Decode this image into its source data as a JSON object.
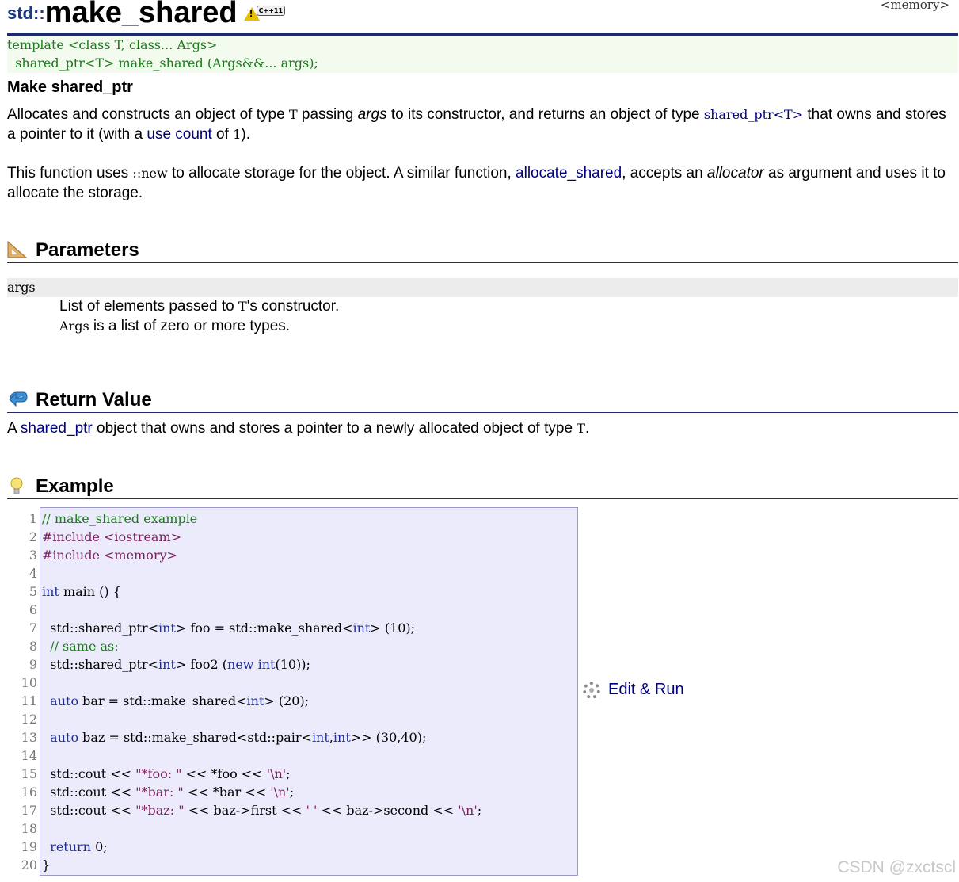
{
  "page": {
    "namespace": "std::",
    "function_name": "make_shared",
    "cxx_badge": "C++11",
    "header": "<memory>",
    "prototype": [
      "template <class T, class... Args>",
      "  shared_ptr<T> make_shared (Args&&... args);"
    ],
    "subtitle": "Make shared_ptr"
  },
  "description": {
    "p1_a": "Allocates and constructs an object of type ",
    "p1_T": "T",
    "p1_b": " passing ",
    "p1_args": "args",
    "p1_c": " to its constructor, and returns an object of type ",
    "p1_link": "shared_ptr<T>",
    "p1_d": " that owns and stores a pointer to it (with a ",
    "p1_link2": "use count",
    "p1_e": " of ",
    "p1_one": "1",
    "p1_f": ").",
    "p2_a": "This function uses ",
    "p2_new": "::new",
    "p2_b": " to allocate storage for the object. A similar function, ",
    "p2_link": "allocate_shared",
    "p2_c": ", accepts an ",
    "p2_alloc": "allocator",
    "p2_d": " as argument and uses it to allocate the storage."
  },
  "sections": {
    "parameters": "Parameters",
    "return_value": "Return Value",
    "example": "Example"
  },
  "parameters": {
    "name": "args",
    "desc1_a": "List of elements passed to ",
    "desc1_T": "T",
    "desc1_b": "'s constructor.",
    "desc2_Args": "Args",
    "desc2_b": " is a list of zero or more types."
  },
  "return_value": {
    "a": "A ",
    "link": "shared_ptr",
    "b": " object that owns and stores a pointer to a newly allocated object of type ",
    "T": "T",
    "c": "."
  },
  "example": {
    "line_numbers": [
      "1",
      "2",
      "3",
      "4",
      "5",
      "6",
      "7",
      "8",
      "9",
      "10",
      "11",
      "12",
      "13",
      "14",
      "15",
      "16",
      "17",
      "18",
      "19",
      "20"
    ],
    "lines": [
      "// make_shared example",
      "#include <iostream>",
      "#include <memory>",
      "",
      "int main () {",
      "",
      "  std::shared_ptr<int> foo = std::make_shared<int> (10);",
      "  // same as:",
      "  std::shared_ptr<int> foo2 (new int(10));",
      "",
      "  auto bar = std::make_shared<int> (20);",
      "",
      "  auto baz = std::make_shared<std::pair<int,int>> (30,40);",
      "",
      "  std::cout << \"*foo: \" << *foo << '\\n';",
      "  std::cout << \"*bar: \" << *bar << '\\n';",
      "  std::cout << \"*baz: \" << baz->first << ' ' << baz->second << '\\n';",
      "",
      "  return 0;",
      "}"
    ],
    "edit_run": "Edit & Run"
  },
  "watermark": "CSDN @zxctscl",
  "colors": {
    "rule": "#1f2a6e",
    "link": "#000080",
    "code_bg": "#ebebfb",
    "proto_bg": "#f3fbef"
  }
}
